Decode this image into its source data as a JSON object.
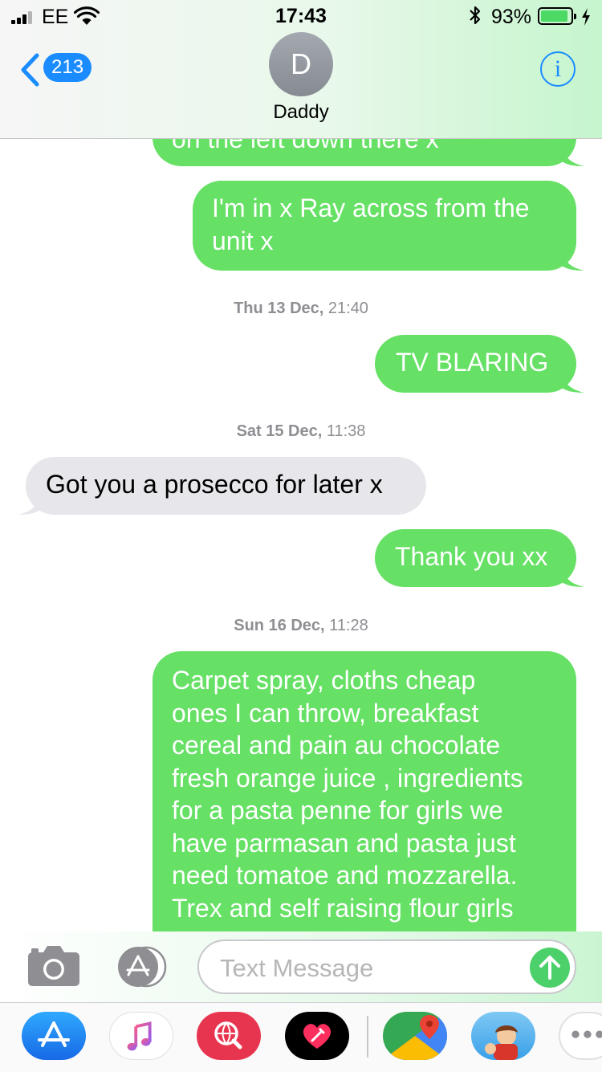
{
  "status_bar": {
    "carrier": "EE",
    "time": "17:43",
    "battery_percent": "93%",
    "battery_level": 0.93
  },
  "header": {
    "back_count": "213",
    "avatar_initial": "D",
    "contact_name": "Daddy",
    "info_label": "i"
  },
  "messages": [
    {
      "type": "outgoing",
      "lines": [
        "on the left down there x"
      ]
    },
    {
      "type": "outgoing",
      "lines": [
        "I'm in x Ray across from the",
        "unit x"
      ]
    },
    {
      "type": "timestamp",
      "day": "Thu 13 Dec,",
      "time": " 21:40"
    },
    {
      "type": "outgoing",
      "lines": [
        "TV BLARING"
      ]
    },
    {
      "type": "timestamp",
      "day": "Sat 15 Dec,",
      "time": " 11:38"
    },
    {
      "type": "incoming",
      "lines": [
        "Got you a prosecco for later x"
      ]
    },
    {
      "type": "outgoing",
      "lines": [
        "Thank you xx"
      ]
    },
    {
      "type": "timestamp",
      "day": "Sun 16 Dec,",
      "time": " 11:28"
    },
    {
      "type": "outgoing",
      "lines": [
        "Carpet spray, cloths cheap",
        "ones I can throw, breakfast",
        "cereal and pain au chocolate",
        "fresh orange juice , ingredients",
        "for a pasta penne for girls we",
        "have parmasan and pasta just",
        "need tomatoe and mozzarella.",
        "Trex and self raising flour girls"
      ]
    }
  ],
  "composer": {
    "placeholder": "Text Message"
  },
  "drawer": {
    "apps": [
      {
        "name": "app-store-icon"
      },
      {
        "name": "music-icon"
      },
      {
        "name": "web-search-icon"
      },
      {
        "name": "digital-touch-icon"
      },
      {
        "name": "google-maps-icon"
      },
      {
        "name": "animoji-icon"
      },
      {
        "name": "more-icon"
      }
    ]
  },
  "colors": {
    "outgoing": "#66e065",
    "incoming": "#e6e6eb",
    "accent": "#1a8cff",
    "send": "#4bd06a"
  }
}
